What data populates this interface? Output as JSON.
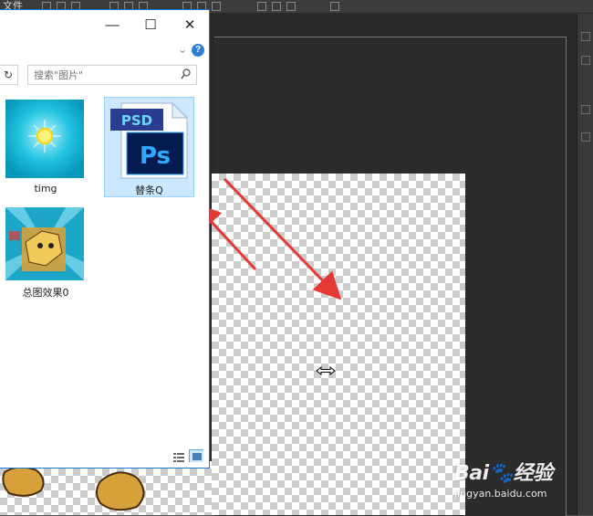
{
  "photoshop": {
    "menu_label": "文件",
    "accent_red": "#e53935"
  },
  "explorer": {
    "title_buttons": {
      "minimize": "—",
      "maximize": "☐",
      "close": "✕"
    },
    "help": "?",
    "search": {
      "placeholder": "搜索\"图片\""
    },
    "files": [
      {
        "name": "timg",
        "icon": "sun-burst-thumbnail",
        "selected": false
      },
      {
        "name": "替条Q",
        "icon": "psd-file-icon",
        "selected": true
      },
      {
        "name": "总图效果0",
        "icon": "cartoon-image-thumbnail",
        "selected": false
      }
    ],
    "psd_badge": "PSD",
    "ps_logo": "Ps",
    "view_modes": [
      "details-view-icon",
      "large-icons-view-icon"
    ]
  },
  "watermark": {
    "brand": "Bai",
    "brand_suffix": "经验",
    "url": "jingyan.baidu.com"
  }
}
